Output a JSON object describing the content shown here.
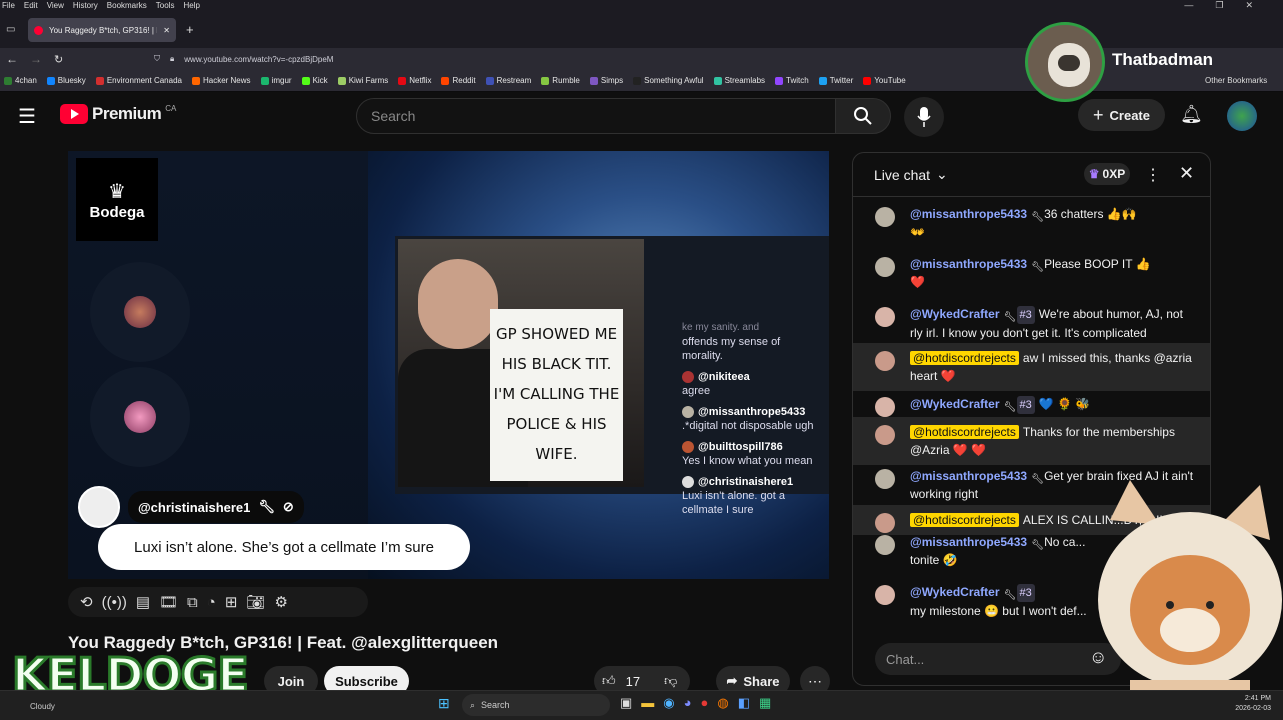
{
  "browser": {
    "menu": [
      "File",
      "Edit",
      "View",
      "History",
      "Bookmarks",
      "Tools",
      "Help"
    ],
    "tab_title": "You Raggedy B*tch, GP316! | Fc",
    "url": "www.youtube.com/watch?v=-cpzdBjDpeM",
    "bookmarks": [
      {
        "label": "4chan",
        "color": "#2e7d32"
      },
      {
        "label": "Bluesky",
        "color": "#1185fe"
      },
      {
        "label": "Environment Canada",
        "color": "#d32f2f"
      },
      {
        "label": "Hacker News",
        "color": "#ff6600"
      },
      {
        "label": "imgur",
        "color": "#1bb76e"
      },
      {
        "label": "Kick",
        "color": "#53fc18"
      },
      {
        "label": "Kiwi Farms",
        "color": "#9ccc65"
      },
      {
        "label": "Netflix",
        "color": "#e50914"
      },
      {
        "label": "Reddit",
        "color": "#ff4500"
      },
      {
        "label": "Restream",
        "color": "#3f51b5"
      },
      {
        "label": "Rumble",
        "color": "#85c742"
      },
      {
        "label": "Simps",
        "color": "#7e57c2"
      },
      {
        "label": "Something Awful",
        "color": "#222"
      },
      {
        "label": "Streamlabs",
        "color": "#31c3a2"
      },
      {
        "label": "Twitch",
        "color": "#9146ff"
      },
      {
        "label": "Twitter",
        "color": "#1da1f2"
      },
      {
        "label": "YouTube",
        "color": "#ff0000"
      }
    ],
    "other_bookmarks": "Other Bookmarks"
  },
  "yt": {
    "logo": "Premium",
    "region": "CA",
    "search_placeholder": "Search",
    "create": "Create"
  },
  "video": {
    "brand": "Bodega",
    "sign_lines": [
      "GP SHOWED ME",
      "HIS BLACK TIT.",
      "I'M CALLING THE",
      "POLICE & HIS",
      "WIFE."
    ],
    "overlay_chat": [
      {
        "name": "",
        "text": "offends my sense of morality.",
        "partial": "ke my sanity. and"
      },
      {
        "name": "@nikiteea",
        "text": "agree"
      },
      {
        "name": "@missanthrope5433",
        "text": ".*digital not disposable ugh"
      },
      {
        "name": "@builttospill786",
        "text": "Yes I know what you mean"
      },
      {
        "name": "@christinaishere1",
        "text": "Luxi isn't alone. got a cellmate I sure"
      }
    ],
    "bubble_name": "@christinaishere1",
    "bubble_msg": "Luxi isn’t alone. She’s got a cellmate I’m sure",
    "title": "You Raggedy B*tch, GP316! | Feat. @alexglitterqueen",
    "join": "Join",
    "subscribe": "Subscribe",
    "likes": "17",
    "share": "Share"
  },
  "chat": {
    "header": "Live chat",
    "xp": "0XP",
    "input_placeholder": "Chat...",
    "messages": [
      {
        "author": "@missanthrope5433",
        "rank": "",
        "text": "36 chatters 👍🙌",
        "extra": "👐",
        "hl": false,
        "avatar": "#b9b2a4"
      },
      {
        "author": "@missanthrope5433",
        "rank": "",
        "text": "Please BOOP IT 👍",
        "extra": "❤️",
        "hl": false,
        "avatar": "#b9b2a4"
      },
      {
        "author": "@WykedCrafter",
        "rank": "#3",
        "text": "We're about humor, AJ, not rly irl. I know you don't get it. It's complicated",
        "extra": "",
        "hl": false,
        "avatar": "#d8b4a8"
      },
      {
        "author": "@hotdiscordrejects",
        "rank": "",
        "text": "aw I missed this, thanks @azria heart ❤️",
        "extra": "",
        "hl": true,
        "avatar": "#c99a8a"
      },
      {
        "author": "@WykedCrafter",
        "rank": "#3",
        "text": "💙 🌻 🐝",
        "extra": "",
        "hl": false,
        "avatar": "#d8b4a8"
      },
      {
        "author": "@hotdiscordrejects",
        "rank": "",
        "text": "Thanks for the memberships @Azria ❤️ ❤️",
        "extra": "",
        "hl": true,
        "avatar": "#c99a8a"
      },
      {
        "author": "@missanthrope5433",
        "rank": "",
        "text": "Get yer brain fixed AJ it ain't working right",
        "extra": "",
        "hl": false,
        "avatar": "#b9b2a4"
      },
      {
        "author": "@hotdiscordrejects",
        "rank": "",
        "text": "ALEX IS CALLIN...DY, A.!!!",
        "extra": "",
        "hl": true,
        "avatar": "#c99a8a"
      },
      {
        "author": "@missanthrope5433",
        "rank": "",
        "text": "No ca...",
        "extra": "tonite 🤣",
        "hl": false,
        "avatar": "#b9b2a4"
      },
      {
        "author": "@WykedCrafter",
        "rank": "#3",
        "text": "",
        "extra": "my milestone 😬 but I won't def...",
        "hl": false,
        "avatar": "#d8b4a8"
      }
    ]
  },
  "overlay": {
    "streamer": "Thatbadman",
    "keldoge": "KELDOGE"
  },
  "taskbar": {
    "weather": "Cloudy",
    "search": "Search",
    "time": "2:41 PM",
    "date": "2026-02-03"
  }
}
